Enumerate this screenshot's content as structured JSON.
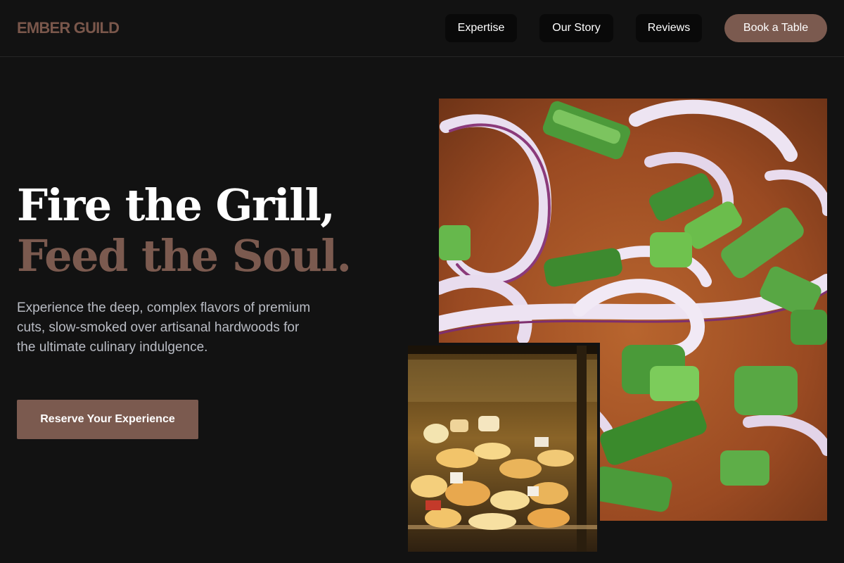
{
  "header": {
    "logo": "EMBER GUILD",
    "nav": [
      {
        "label": "Expertise"
      },
      {
        "label": "Our Story"
      },
      {
        "label": "Reviews"
      }
    ],
    "cta_label": "Book a Table"
  },
  "hero": {
    "title_line1": "Fire the Grill,",
    "title_line2": "Feed the Soul.",
    "description": "Experience the deep, complex flavors of premium cuts, slow-smoked over artisanal hardwoods for the ultimate culinary indulgence.",
    "cta_label": "Reserve Your Experience"
  },
  "colors": {
    "background": "#121212",
    "accent": "#7b5a4f",
    "nav_button": "#090909",
    "description_text": "#b9bcc4"
  }
}
